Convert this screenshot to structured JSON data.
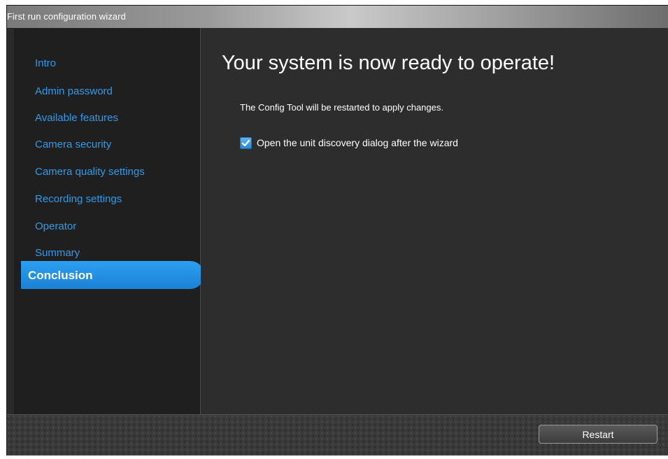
{
  "window": {
    "title": "First run configuration wizard"
  },
  "sidebar": {
    "items": [
      {
        "label": "Intro"
      },
      {
        "label": "Admin password"
      },
      {
        "label": "Available features"
      },
      {
        "label": "Camera security"
      },
      {
        "label": "Camera quality settings"
      },
      {
        "label": "Recording settings"
      },
      {
        "label": "Operator"
      },
      {
        "label": "Summary"
      },
      {
        "label": "Conclusion",
        "active": true
      }
    ]
  },
  "main": {
    "title": "Your system is now ready to operate!",
    "subtitle": "The Config Tool will be restarted to apply changes.",
    "checkbox": {
      "label": "Open the unit discovery dialog after the wizard",
      "checked": true
    }
  },
  "footer": {
    "restart_label": "Restart"
  },
  "colors": {
    "accent": "#1b82d6",
    "link": "#2f9be8",
    "sidebar_bg": "#1f1f1f",
    "main_bg": "#2d2d2d"
  },
  "icons": {
    "checkbox": "checkmark-icon"
  }
}
